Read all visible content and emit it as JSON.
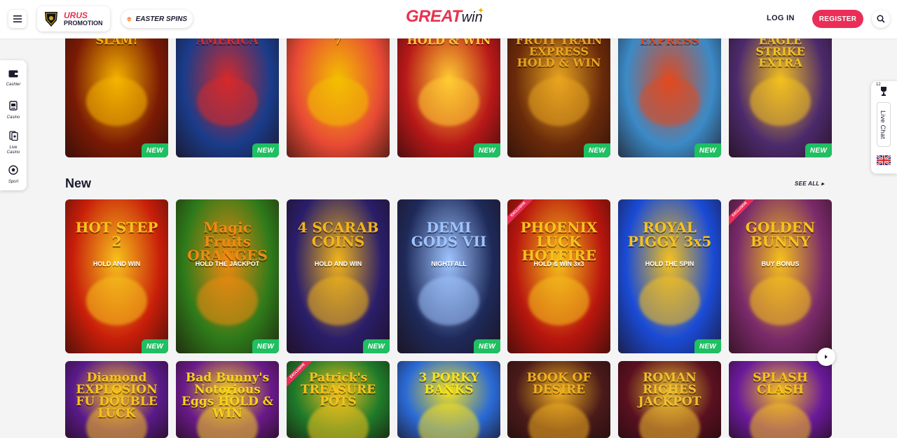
{
  "header": {
    "menu_icon": "hamburger-icon",
    "urus_line1": "URUS",
    "urus_line2": "PROMOTION",
    "easter_label": "EASTER SPINS",
    "logo_great": "GREAT",
    "logo_win": "win",
    "login_label": "LOG IN",
    "register_label": "REGISTER",
    "search_icon": "search-icon"
  },
  "sidebar": {
    "items": [
      {
        "label": "Cashier",
        "icon": "wallet-icon"
      },
      {
        "label": "Casino",
        "icon": "slot-machine-icon"
      },
      {
        "label": "Live Casino",
        "icon": "cards-icon"
      },
      {
        "label": "Sport",
        "icon": "soccer-ball-icon"
      }
    ]
  },
  "rightbar": {
    "notification_count": "12",
    "live_chat_label": "Live Chat",
    "language_icon": "uk-flag-icon"
  },
  "row_top": {
    "games": [
      {
        "title": "SLAM!",
        "badge": "NEW",
        "bg": "#7a1a05",
        "accent": "#f5b400"
      },
      {
        "title": "AMERICA",
        "badge": "NEW",
        "bg": "#1a3c8a",
        "accent": "#d62a2a"
      },
      {
        "title": "7",
        "badge": "",
        "bg": "#e84a35",
        "accent": "#f3c000"
      },
      {
        "title": "HOLD & WIN",
        "badge": "NEW",
        "bg": "#b81818",
        "accent": "#ffcc33"
      },
      {
        "title": "FRUIT TRAIN EXPRESS HOLD & WIN",
        "badge": "NEW",
        "bg": "#6a2a0a",
        "accent": "#e8a520"
      },
      {
        "title": "EXPRESS",
        "badge": "NEW",
        "bg": "#3b8ac7",
        "accent": "#e04a20"
      },
      {
        "title": "EAGLE STRIKE EXTRA",
        "badge": "NEW",
        "bg": "#4c2a6c",
        "accent": "#f2c020"
      }
    ]
  },
  "section_new": {
    "title": "New",
    "see_all_label": "SEE ALL",
    "games": [
      {
        "title": "HOT STEP 2",
        "subtitle": "HOLD AND WIN",
        "badge": "NEW",
        "exclusive": "",
        "bg": "#c81e0a",
        "accent": "#f7c21c"
      },
      {
        "title": "Magic Fruits ORANGES",
        "subtitle": "HOLD THE JACKPOT",
        "badge": "NEW",
        "exclusive": "",
        "bg": "#2e7a1a",
        "accent": "#f08a10"
      },
      {
        "title": "4 SCARAB COINS",
        "subtitle": "HOLD AND WIN",
        "badge": "NEW",
        "exclusive": "",
        "bg": "#2a1e6a",
        "accent": "#f2b51a"
      },
      {
        "title": "DEMI GODS VII",
        "subtitle": "NIGHTFALL",
        "badge": "NEW",
        "exclusive": "",
        "bg": "#1e2a5a",
        "accent": "#9fc4ff"
      },
      {
        "title": "PHOENIX LUCK HOTFIRE",
        "subtitle": "HOLD & WIN 3x3",
        "badge": "",
        "exclusive": "EXCLUSIVE",
        "bg": "#b8160e",
        "accent": "#f7c21c"
      },
      {
        "title": "ROYAL PIGGY 3x5",
        "subtitle": "HOLD THE SPIN",
        "badge": "NEW",
        "exclusive": "",
        "bg": "#1a4bd6",
        "accent": "#f7c21c"
      },
      {
        "title": "GOLDEN BUNNY",
        "subtitle": "BUY BONUS",
        "badge": "",
        "exclusive": "EXCLUSIVE",
        "bg": "#7a2a6a",
        "accent": "#f7c21c"
      }
    ]
  },
  "row_bottom": {
    "games": [
      {
        "title": "Diamond EXPLOSION FU DOUBLE LUCK",
        "exclusive": "",
        "bg": "#5a1a8a",
        "accent": "#f7c21c"
      },
      {
        "title": "Bad Bunny's Notorious Eggs HOLD & WIN",
        "exclusive": "",
        "bg": "#6a1a8a",
        "accent": "#f7d21c"
      },
      {
        "title": "Patrick's TREASURE POTS",
        "exclusive": "EXCLUSIVE",
        "bg": "#1e7a2a",
        "accent": "#f7c21c"
      },
      {
        "title": "3 PORKY BANKS",
        "exclusive": "",
        "bg": "#2a6ad6",
        "accent": "#f7e21c"
      },
      {
        "title": "BOOK OF DESIRE",
        "exclusive": "",
        "bg": "#4a1a1a",
        "accent": "#f0b020"
      },
      {
        "title": "ROMAN RICHES JACKPOT",
        "exclusive": "",
        "bg": "#5a1020",
        "accent": "#f0c030"
      },
      {
        "title": "SPLASH CLASH",
        "exclusive": "",
        "bg": "#6a1a9a",
        "accent": "#f7c21c"
      }
    ]
  },
  "carousel_next_icon": "chevron-right-icon"
}
